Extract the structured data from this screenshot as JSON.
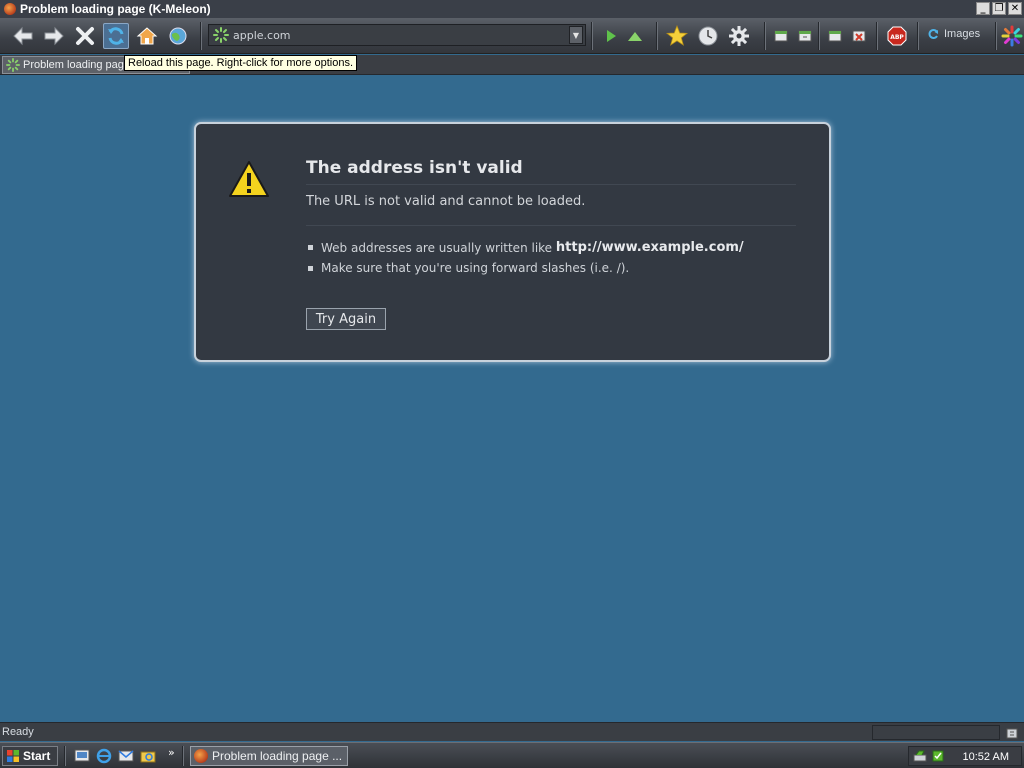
{
  "window": {
    "title": "Problem loading page (K-Meleon)"
  },
  "window_buttons": {
    "minimize": "_",
    "restore": "❐",
    "close": "✕"
  },
  "address_bar": {
    "value": "apple.com",
    "dropdown": "▼"
  },
  "toolbar": {
    "buttons": [
      "back-icon",
      "forward-icon",
      "stop-icon",
      "reload-icon",
      "home-icon",
      "go-icon",
      "play-icon",
      "up-icon",
      "bookmarks-icon",
      "history-icon",
      "settings-icon",
      "window-icons",
      "abp-icon"
    ],
    "images_label": "Images"
  },
  "tab": {
    "label": "Problem loading page"
  },
  "tooltip": {
    "text": "Reload this page. Right-click for more options."
  },
  "error": {
    "title": "The address isn't valid",
    "description": "The URL is not valid and cannot be loaded.",
    "tips": [
      {
        "text": "Web addresses are usually written like ",
        "bold": "http://www.example.com/"
      },
      {
        "text": "Make sure that you're using forward slashes (i.e. /).",
        "bold": ""
      }
    ],
    "button": "Try Again"
  },
  "statusbar": {
    "status": "Ready"
  },
  "taskbar": {
    "start": "Start",
    "task_label": "Problem loading page ...",
    "more": "»",
    "clock": "10:52 AM"
  },
  "colors": {
    "content_bg": "#336a8f",
    "error_box": "#333942",
    "tooltip_bg": "#ffffe1"
  }
}
